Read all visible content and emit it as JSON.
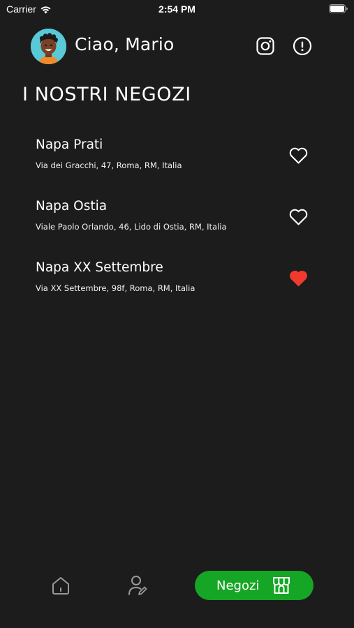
{
  "status_bar": {
    "carrier": "Carrier",
    "time": "2:54 PM"
  },
  "header": {
    "greeting": "Ciao, Mario",
    "instagram_icon": "instagram-icon",
    "info_icon": "info-icon"
  },
  "section_title": "I NOSTRI NEGOZI",
  "stores": [
    {
      "name": "Napa Prati",
      "address": "Via dei Gracchi, 47, Roma, RM, Italia",
      "favorite": false
    },
    {
      "name": "Napa Ostia",
      "address": "Viale Paolo Orlando, 46, Lido di Ostia, RM, Italia",
      "favorite": false
    },
    {
      "name": "Napa XX Settembre",
      "address": "Via XX Settembre, 98f, Roma, RM, Italia",
      "favorite": true
    }
  ],
  "tab_bar": {
    "home_icon": "home-icon",
    "profile_icon": "profile-edit-icon",
    "active_label": "Negozi",
    "active_icon": "store-icon"
  },
  "colors": {
    "background": "#1c1c1c",
    "accent_green": "#16a625",
    "favorite_red": "#f03a2e",
    "avatar_bg": "#59c9d8"
  }
}
